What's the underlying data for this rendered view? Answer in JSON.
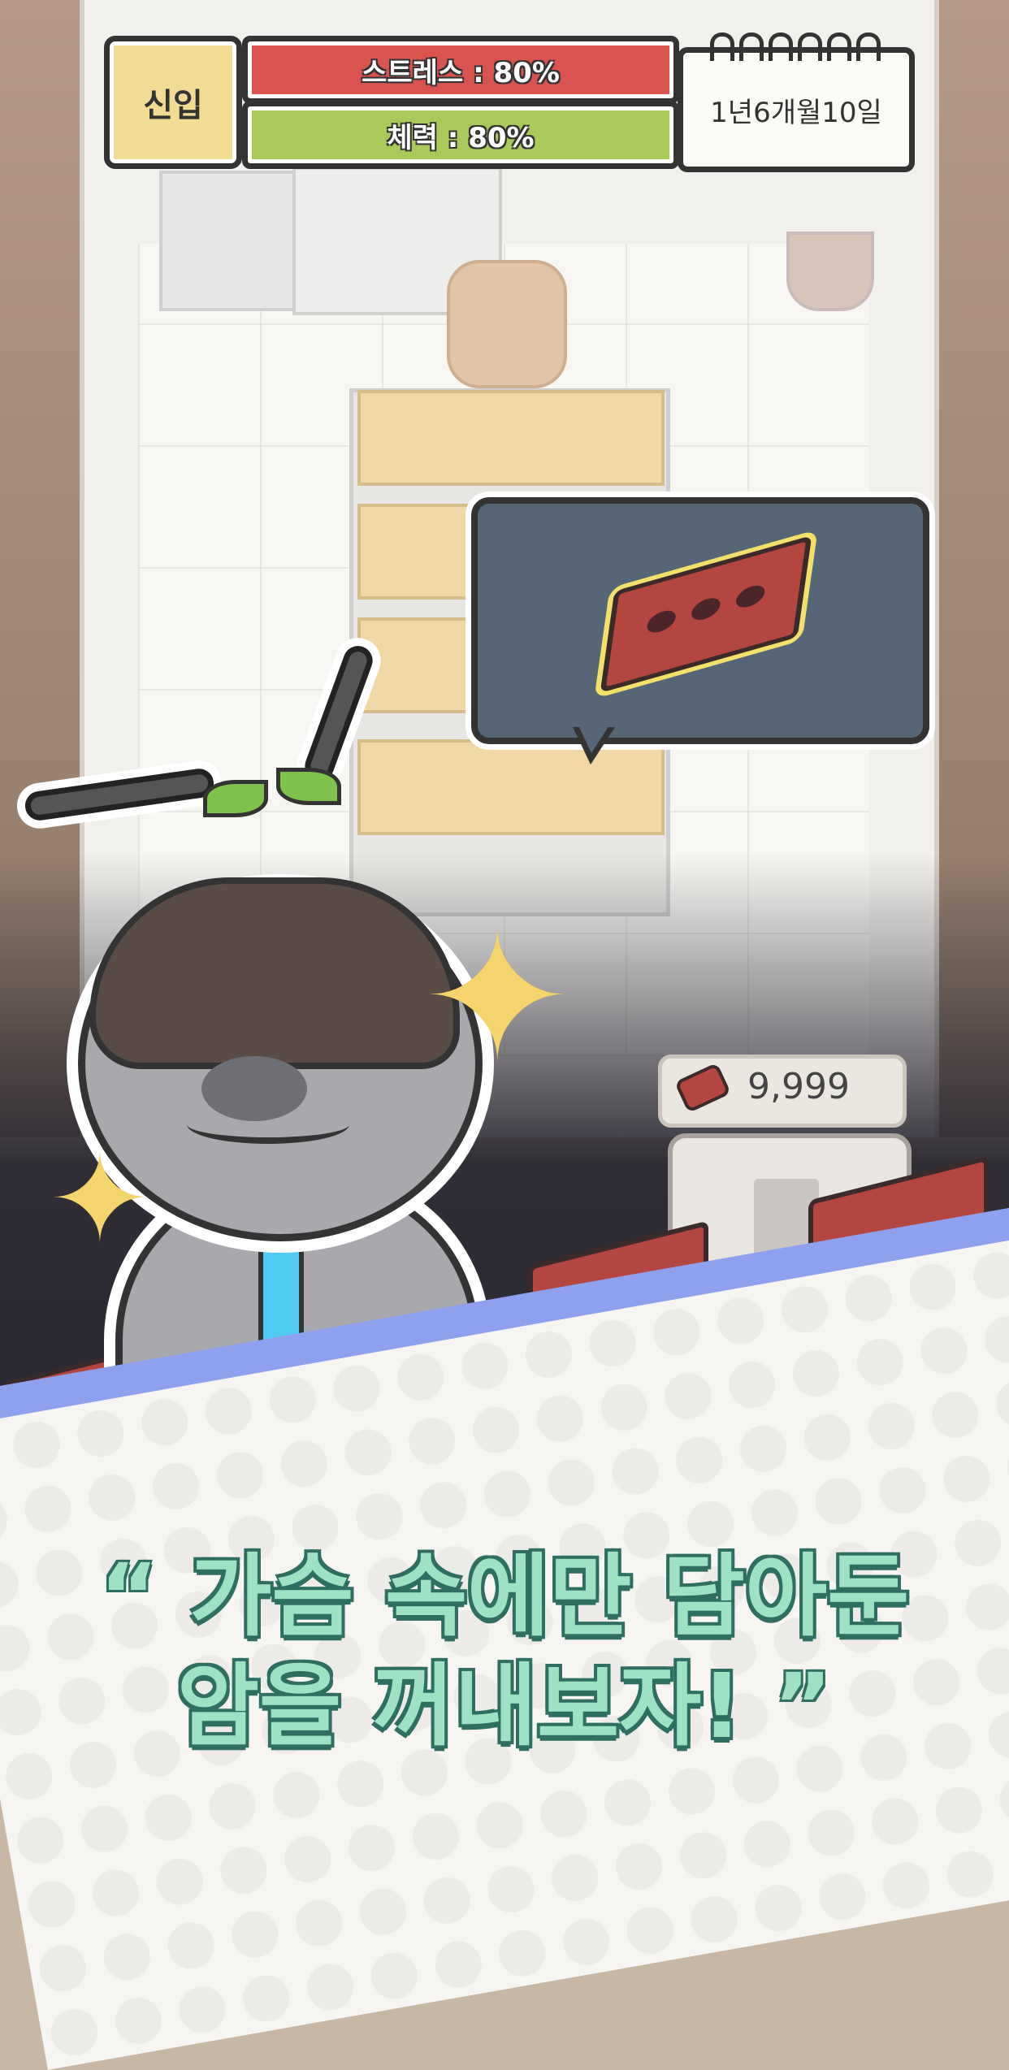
{
  "hud": {
    "rank": "신입",
    "stress_label": "스트레스 : 80%",
    "stamina_label": "체력 : 80%",
    "stress_level": 0.8,
    "stamina_level": 0.8,
    "date": "1년6개월10일"
  },
  "currency": {
    "icon": "brick-icon",
    "value": "9,999"
  },
  "speech_bubble": {
    "icon": "brick-icon"
  },
  "slogan": {
    "open_quote": "“",
    "line1": "가슴 속에만 담아둔",
    "line2": "암을 꺼내보자!",
    "close_quote": "”"
  },
  "colors": {
    "stress": "#d9534f",
    "stamina": "#a9c95a",
    "rank_badge": "#f2dc94",
    "bubble": "#556677",
    "brick": "#b5453f",
    "slogan_fill": "#9fe1c4",
    "slogan_outline": "#2f6e60",
    "tie": "#4fcaf2"
  }
}
